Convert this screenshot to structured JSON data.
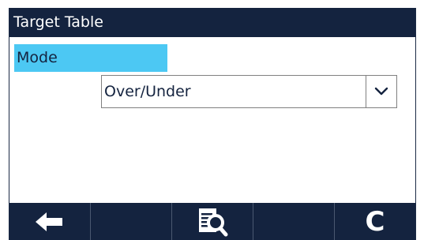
{
  "title_bar": {
    "title": "Target Table"
  },
  "mode": {
    "label": "Mode",
    "selected_value": "Over/Under"
  },
  "softkeys": [
    {
      "name": "back",
      "icon": "left-arrow-icon",
      "label": ""
    },
    {
      "name": "empty-1",
      "icon": "",
      "label": ""
    },
    {
      "name": "view",
      "icon": "document-magnifier-icon",
      "label": ""
    },
    {
      "name": "empty-2",
      "icon": "",
      "label": ""
    },
    {
      "name": "clear",
      "icon": "clear-icon",
      "label": "C"
    }
  ],
  "colors": {
    "title_bar_bg": "#14233f",
    "selection_highlight": "#4cc8f3",
    "softkey_bar_bg": "#14233f"
  }
}
